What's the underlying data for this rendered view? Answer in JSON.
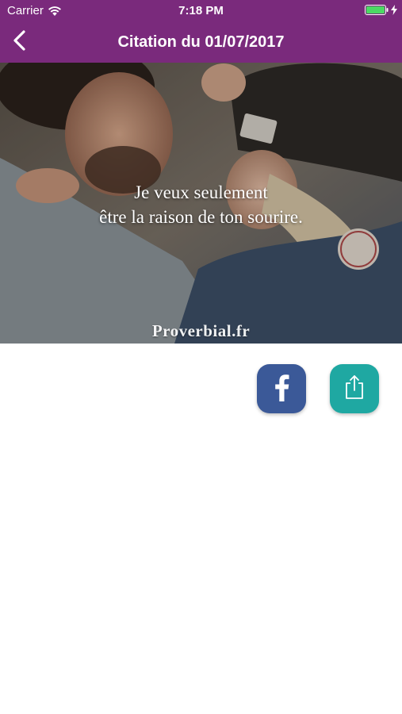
{
  "status_bar": {
    "carrier": "Carrier",
    "time": "7:18 PM",
    "wifi_icon": "wifi-icon",
    "battery_icon": "battery-icon",
    "charging_icon": "bolt-icon"
  },
  "nav": {
    "title": "Citation du 01/07/2017",
    "back_icon": "chevron-left-icon"
  },
  "quote": {
    "line1": "Je veux seulement",
    "line2": "être la raison de ton sourire.",
    "watermark": "Proverbial.fr"
  },
  "actions": {
    "facebook_icon": "facebook-icon",
    "share_icon": "share-icon"
  },
  "colors": {
    "header": "#7a2a7c",
    "facebook": "#3b5998",
    "share": "#1fa8a2",
    "background": "#ffffff"
  }
}
